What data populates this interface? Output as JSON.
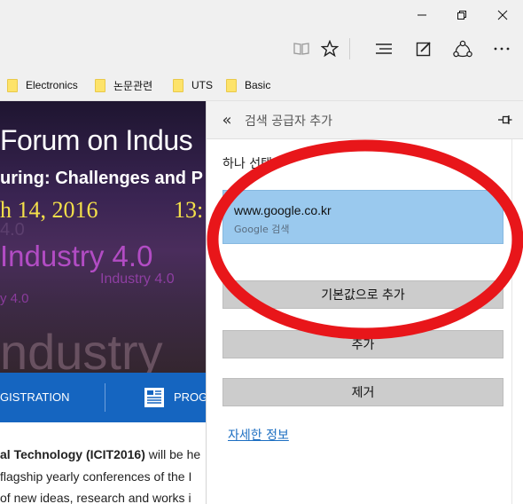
{
  "window": {
    "controls": [
      "minimize-icon",
      "restore-icon",
      "close-icon"
    ]
  },
  "toolbar": {
    "icons": [
      "reading-view-icon",
      "favorite-star-icon",
      "hub-icon",
      "web-note-icon",
      "share-icon",
      "more-icon"
    ]
  },
  "favorites": {
    "items": [
      {
        "label": "Electronics"
      },
      {
        "label": "논문관련"
      },
      {
        "label": "UTS"
      },
      {
        "label": "Basic"
      }
    ]
  },
  "webpage": {
    "banner": {
      "title": "Forum on Indus",
      "subtitle": "uring: Challenges and P",
      "date": "h 14, 2016",
      "time": "13:",
      "industry_ghost": "4.0",
      "industry_big": "Industry 4.0",
      "industry_small": "Industry 4.0",
      "industry_small2": "y 4.0",
      "industry_large": "ndustry"
    },
    "nav": {
      "registration": "GISTRATION",
      "program": "PROG"
    },
    "body": {
      "line1_bold": "al Technology (ICIT2016)",
      "line1_rest": " will be he",
      "line2": "flagship yearly conferences of the I",
      "line3": "of new ideas, research and works i"
    }
  },
  "panel": {
    "title": "검색 공급자 추가",
    "section_label": "하나 선택",
    "engine": {
      "url": "www.google.co.kr",
      "subtitle": "Google 검색"
    },
    "buttons": {
      "add_default": "기본값으로 추가",
      "cancel": "추가",
      "remove": "제거"
    },
    "more_info": "자세한 정보"
  },
  "annotation": {
    "color": "#e8161a"
  }
}
